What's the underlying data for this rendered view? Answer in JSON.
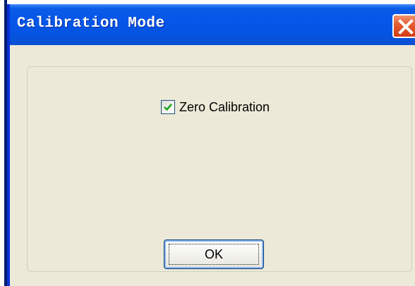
{
  "window": {
    "title": "Calibration Mode"
  },
  "titlebar": {
    "close_icon": "close-icon"
  },
  "options": {
    "zero_calibration": {
      "label": "Zero Calibration",
      "checked": true,
      "check_icon": "checkmark-icon"
    }
  },
  "buttons": {
    "ok_label": "OK"
  },
  "colors": {
    "titlebar": "#0556ea",
    "close_button": "#e45a2e",
    "dialog_background": "#ece9d8",
    "checkmark": "#21a121"
  }
}
